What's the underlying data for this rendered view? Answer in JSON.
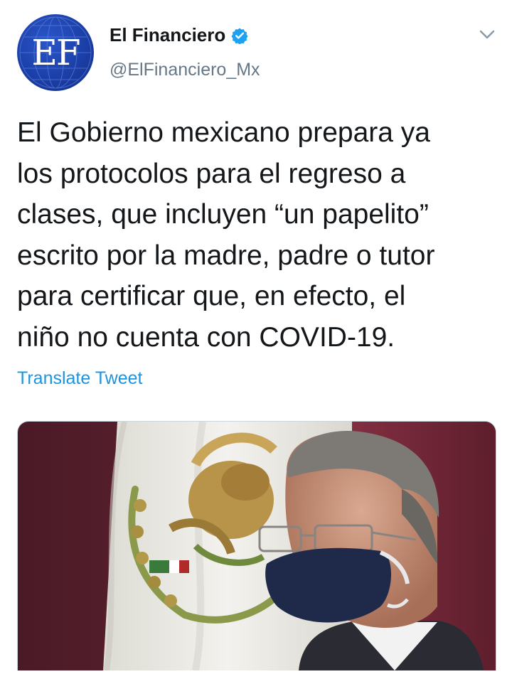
{
  "tweet": {
    "avatar": {
      "initials": "EF",
      "icon": "el-financiero-logo",
      "color": "#1b3fa8"
    },
    "author": {
      "display_name": "El Financiero",
      "handle": "@ElFinanciero_Mx",
      "verified_icon": "verified-badge-icon",
      "verified_color": "#1da1f2"
    },
    "menu_icon": "chevron-down-icon",
    "text_lines": [
      "El Gobierno mexicano prepara ya",
      "los protocolos para el regreso a",
      "clases, que incluyen “un papelito”",
      "escrito por la madre, padre o tutor",
      "para certificar que, en efecto, el",
      "niño no cuenta con COVID-19."
    ],
    "translate_label": "Translate Tweet",
    "translate_color": "#1b95e0",
    "media": {
      "kind": "photo",
      "subject": "man-wearing-navy-face-mask",
      "background": "mexican-flag-coat-of-arms"
    }
  }
}
